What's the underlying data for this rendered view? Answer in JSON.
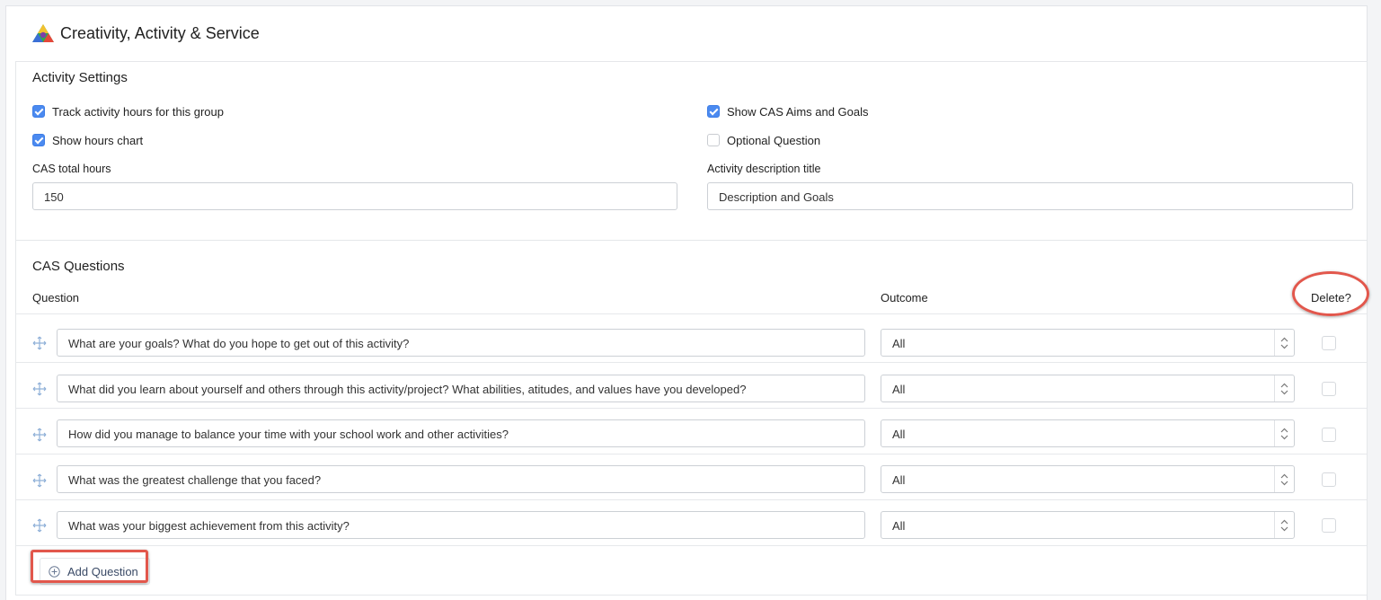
{
  "header": {
    "title": "Creativity, Activity & Service",
    "logo_icon": "cas-triangle-logo"
  },
  "activity_settings": {
    "title": "Activity Settings",
    "track_hours": {
      "label": "Track activity hours for this group",
      "checked": true
    },
    "show_chart": {
      "label": "Show hours chart",
      "checked": true
    },
    "show_aims": {
      "label": "Show CAS Aims and Goals",
      "checked": true
    },
    "optional_question": {
      "label": "Optional Question",
      "checked": false
    },
    "total_hours": {
      "label": "CAS total hours",
      "value": "150"
    },
    "description_title": {
      "label": "Activity description title",
      "value": "Description and Goals"
    }
  },
  "questions": {
    "title": "CAS Questions",
    "col_question": "Question",
    "col_outcome": "Outcome",
    "col_delete": "Delete?",
    "rows": [
      {
        "question": "What are your goals? What do you hope to get out of this activity?",
        "outcome": "All"
      },
      {
        "question": "What did you learn about yourself and others through this activity/project? What abilities, atitudes, and values have you developed?",
        "outcome": "All"
      },
      {
        "question": "How did you manage to balance your time with your school work and other activities?",
        "outcome": "All"
      },
      {
        "question": "What was the greatest challenge that you faced?",
        "outcome": "All"
      },
      {
        "question": "What was your biggest achievement from this activity?",
        "outcome": "All"
      }
    ],
    "add_label": "Add Question"
  },
  "colors": {
    "accent": "#4b8af0",
    "highlight": "#e2574c"
  }
}
